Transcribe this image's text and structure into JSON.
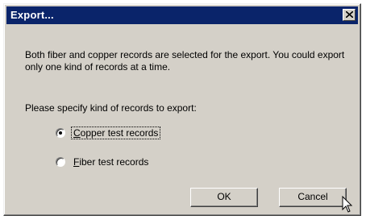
{
  "dialog": {
    "title": "Export...",
    "message": "Both fiber and copper records are selected for the export. You could export only one kind of records at a time.",
    "prompt": "Please specify kind of records to export:",
    "options": [
      {
        "mnemonic": "C",
        "rest": "opper test records",
        "selected": true
      },
      {
        "mnemonic": "F",
        "rest": "iber test records",
        "selected": false
      }
    ],
    "buttons": {
      "ok_label": "OK",
      "cancel_label": "Cancel"
    }
  },
  "icons": {
    "close": "close-icon",
    "cursor": "mouse-pointer-icon"
  },
  "colors": {
    "titlebar": "#0a246a",
    "dialog_face": "#d4d0c8"
  }
}
